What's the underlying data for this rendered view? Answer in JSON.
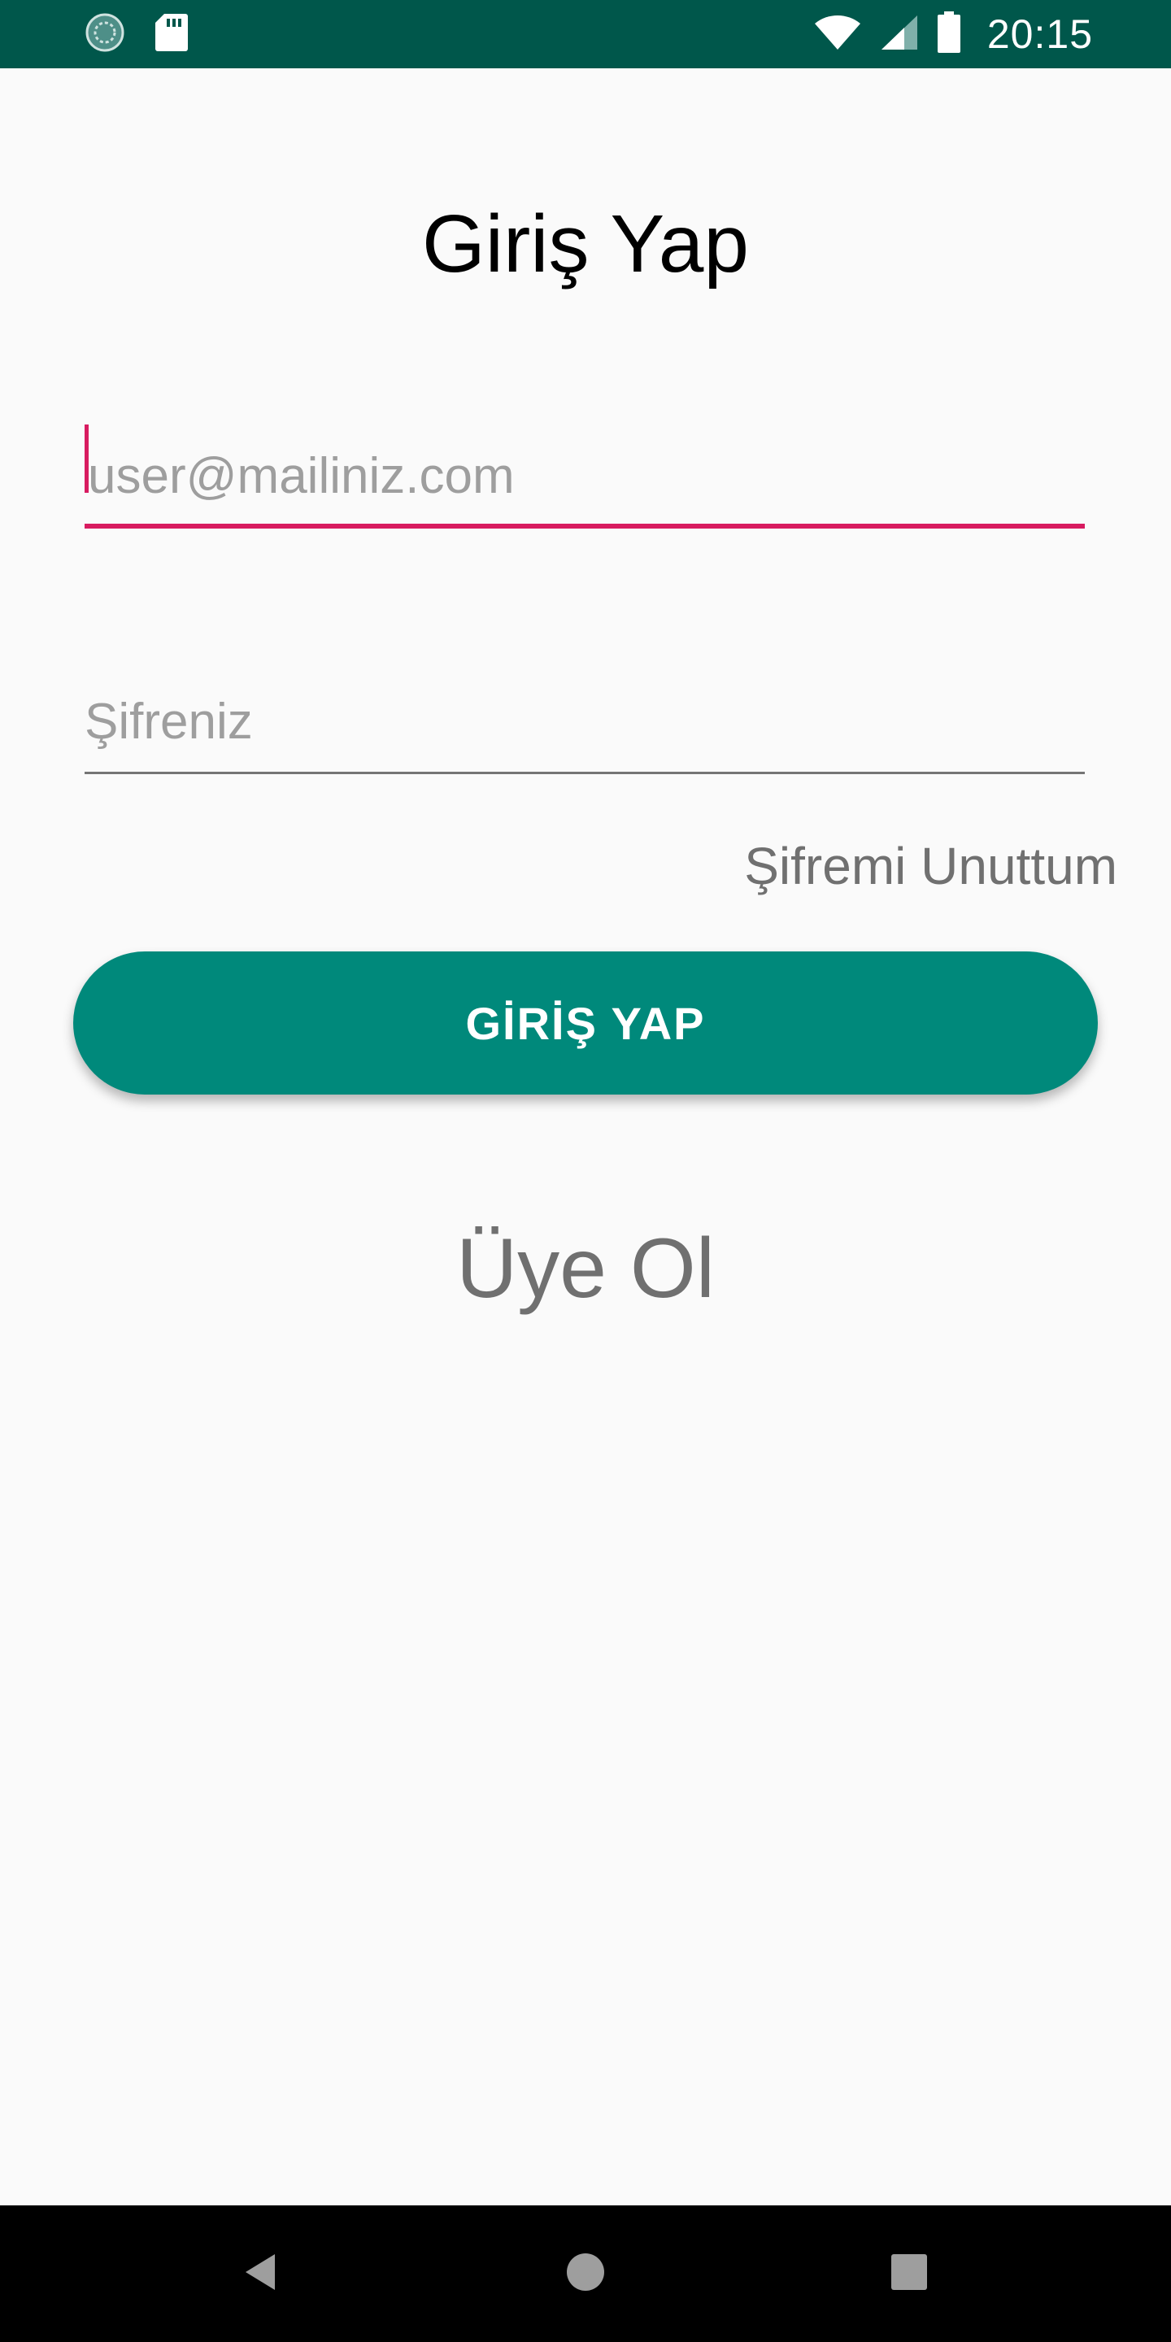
{
  "status_bar": {
    "time": "20:15",
    "icons": [
      "app-notification-icon",
      "sd-card-icon",
      "wifi-icon",
      "cellular-signal-icon",
      "battery-icon"
    ],
    "background": "#00574b"
  },
  "page": {
    "title": "Giriş Yap"
  },
  "form": {
    "email_placeholder": "user@mailiniz.com",
    "email_value": "",
    "password_placeholder": "Şifreniz",
    "password_value": "",
    "forgot_password_label": "Şifremi Unuttum",
    "login_button_label": "GİRİŞ YAP",
    "signup_label": "Üye Ol"
  },
  "colors": {
    "primary_dark": "#00574b",
    "primary": "#00897b",
    "accent": "#d81b60",
    "background": "#fafafa"
  },
  "navigation_bar": {
    "buttons": [
      "back-icon",
      "home-icon",
      "recents-icon"
    ]
  }
}
